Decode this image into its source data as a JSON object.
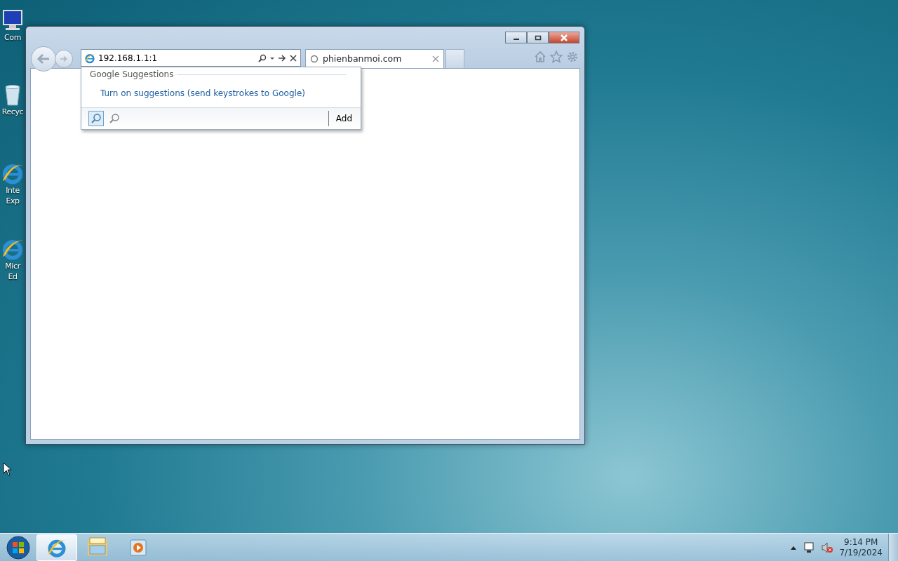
{
  "desktop_icons": [
    {
      "kind": "computer",
      "lines": [
        "Com"
      ]
    },
    {
      "kind": "recycle",
      "lines": [
        "Recyc"
      ]
    },
    {
      "kind": "ie",
      "lines": [
        "Inte",
        "Exp"
      ]
    },
    {
      "kind": "ie",
      "lines": [
        "Micr",
        "Ed"
      ]
    }
  ],
  "browser": {
    "address": "192.168.1.1:1",
    "tabs": [
      {
        "title": "phienbanmoi.com",
        "selected": true
      }
    ],
    "dropdown": {
      "heading": "Google Suggestions",
      "link": "Turn on suggestions (send keystrokes to Google)",
      "providers": [
        {
          "selected": true
        },
        {
          "selected": false
        }
      ],
      "add_button": "Add"
    }
  },
  "taskbar": {
    "items": [
      {
        "kind": "ie",
        "active": true
      },
      {
        "kind": "explorer",
        "active": false
      },
      {
        "kind": "media",
        "active": false
      }
    ],
    "time": "9:14 PM",
    "date": "7/19/2024"
  }
}
